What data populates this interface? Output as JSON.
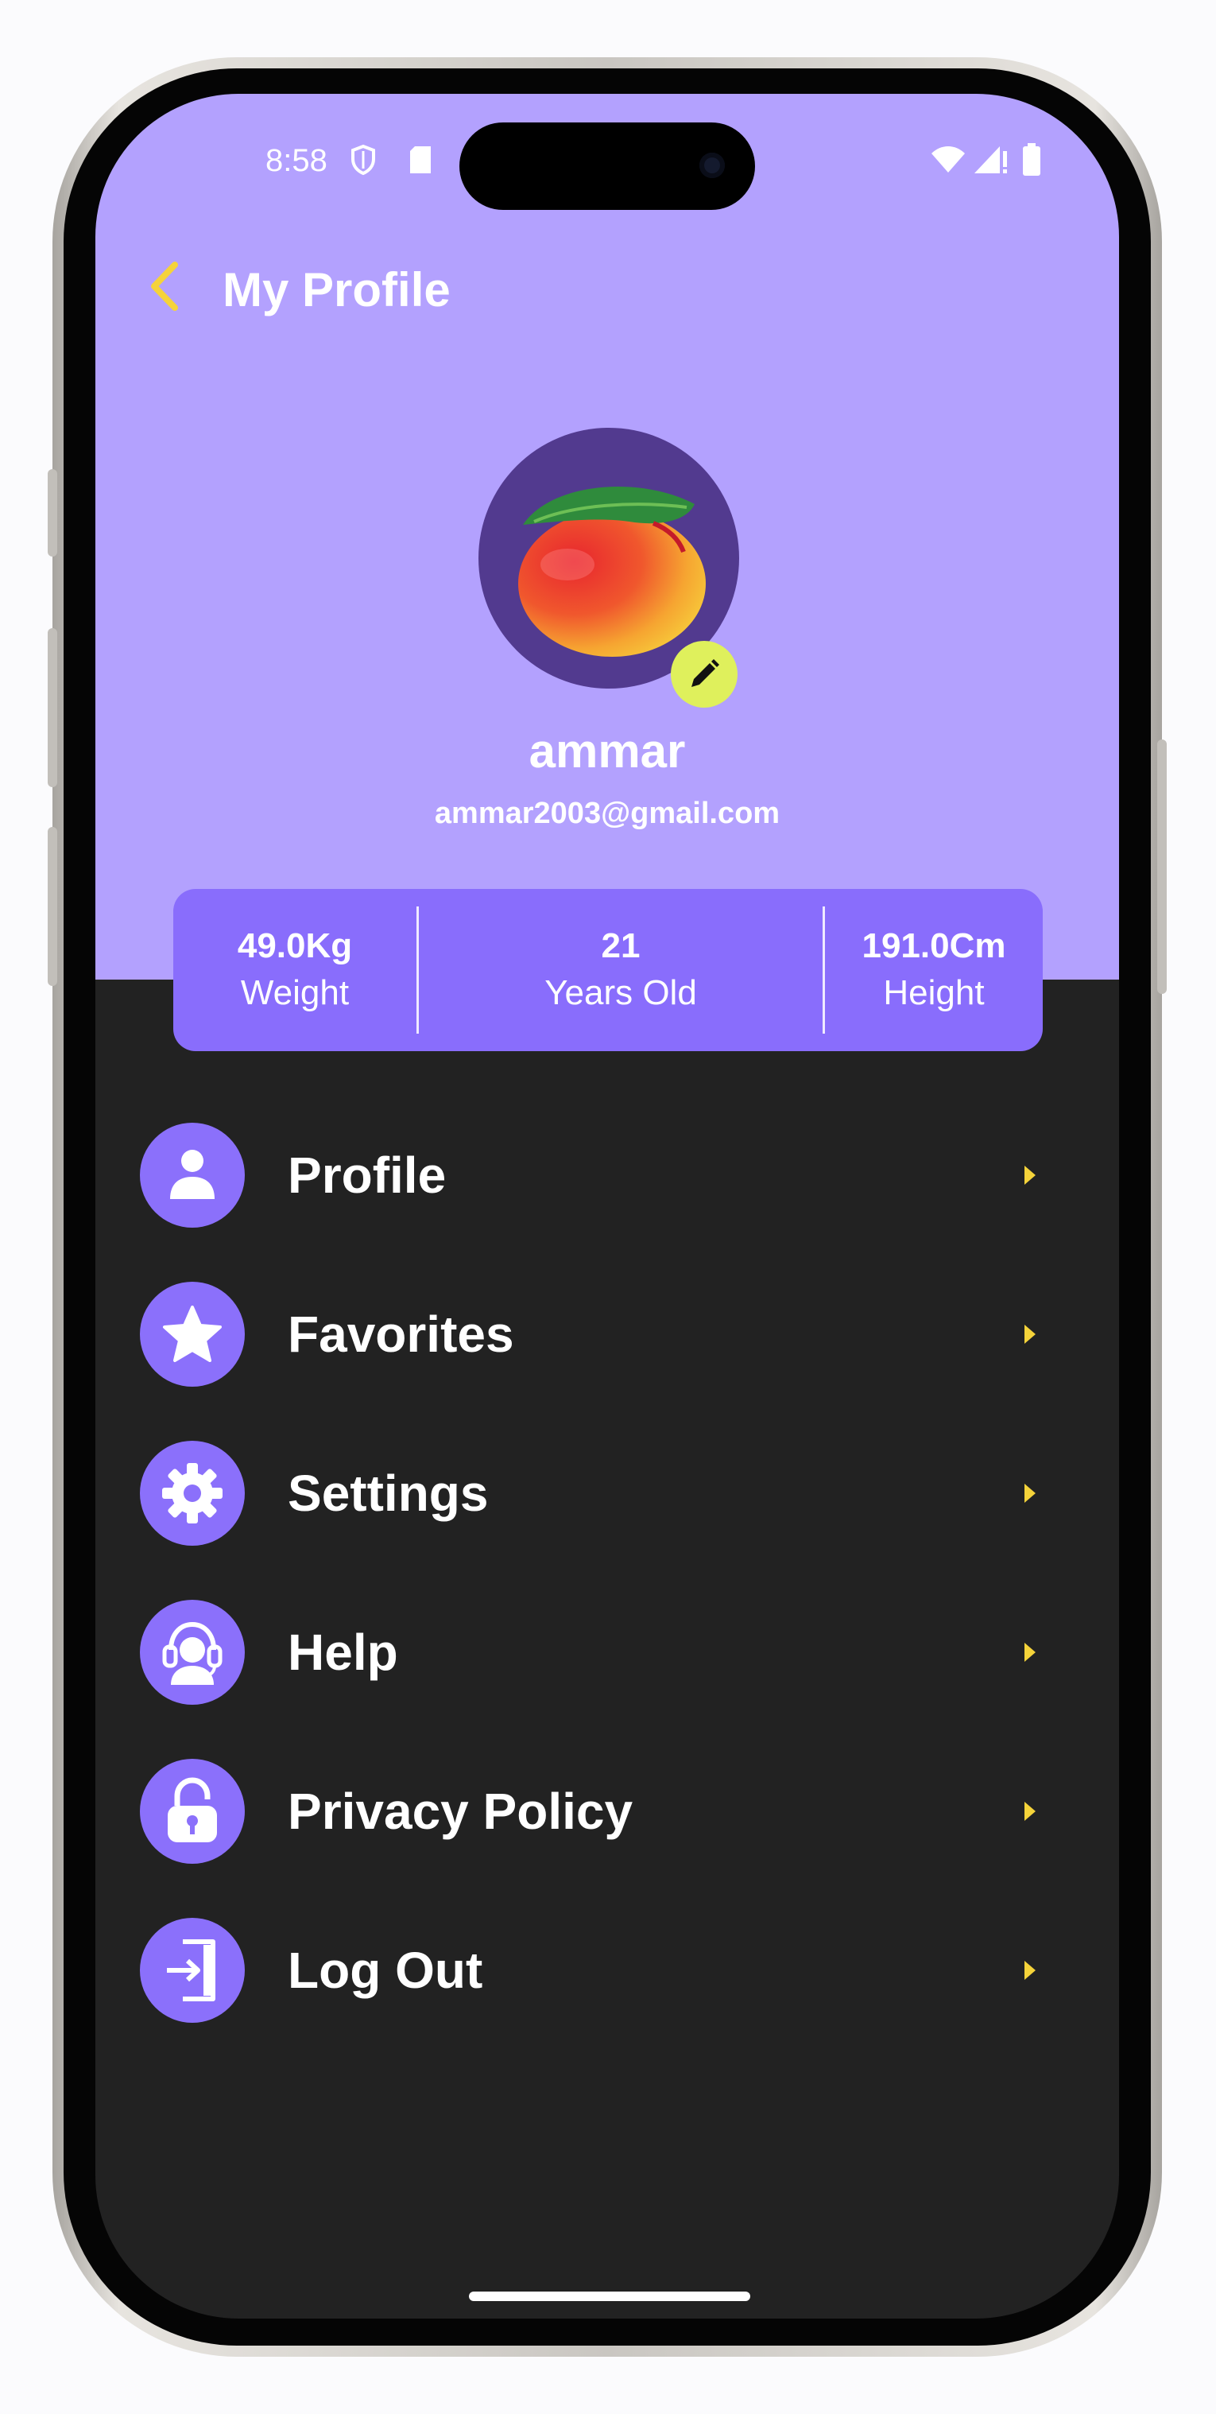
{
  "status_bar": {
    "time": "8:58"
  },
  "header": {
    "title": "My Profile"
  },
  "profile": {
    "name": "ammar",
    "email": "ammar2003@gmail.com"
  },
  "stats": [
    {
      "value": "49.0Kg",
      "label": "Weight"
    },
    {
      "value": "21",
      "label": "Years Old"
    },
    {
      "value": "191.0Cm",
      "label": "Height"
    }
  ],
  "menu": [
    {
      "label": "Profile",
      "icon": "person-icon"
    },
    {
      "label": "Favorites",
      "icon": "star-icon"
    },
    {
      "label": "Settings",
      "icon": "gear-icon"
    },
    {
      "label": "Help",
      "icon": "headset-icon"
    },
    {
      "label": "Privacy Policy",
      "icon": "lock-icon"
    },
    {
      "label": "Log Out",
      "icon": "logout-icon"
    }
  ],
  "colors": {
    "header_bg": "#b3a1fe",
    "card_bg": "#896dfc",
    "icon_bg": "#8b70fb",
    "screen_bg": "#222222",
    "accent_yellow": "#f5d33a",
    "edit_badge": "#dff05c"
  }
}
